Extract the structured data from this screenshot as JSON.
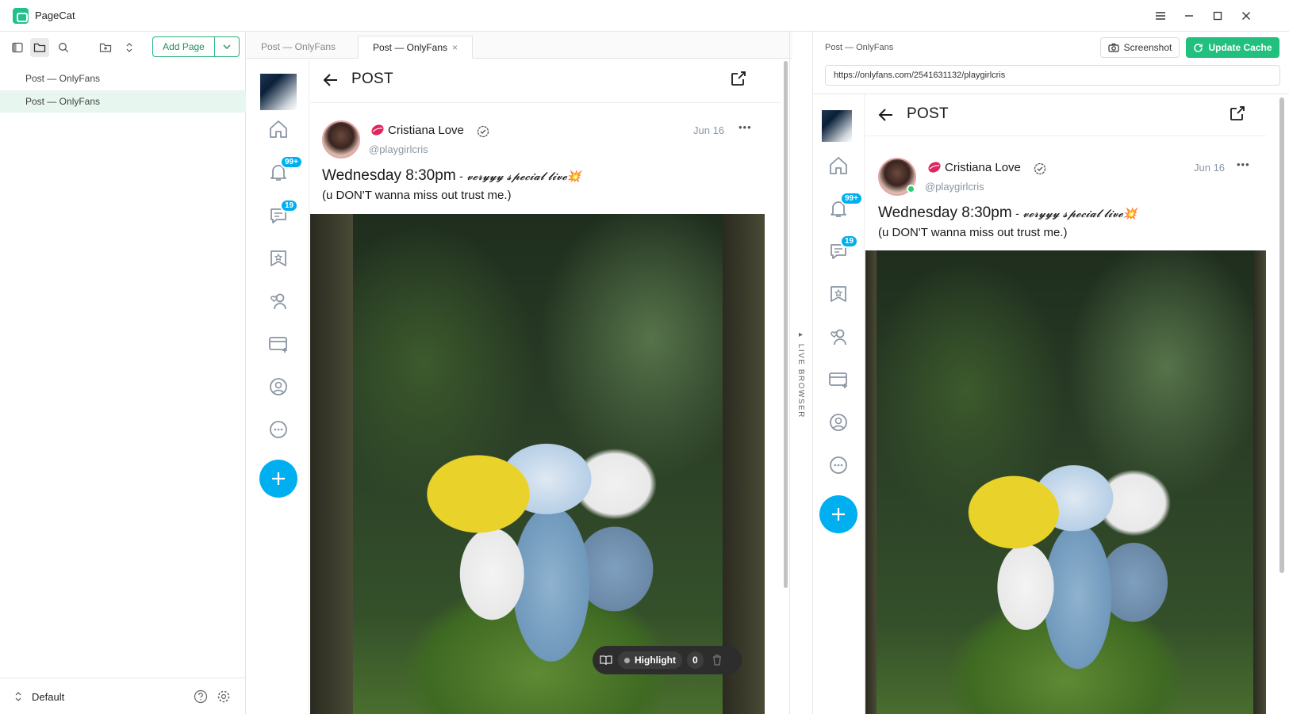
{
  "app": {
    "title": "PageCat"
  },
  "sidebar": {
    "add_page_label": "Add Page",
    "items": [
      {
        "label": "Post — OnlyFans"
      },
      {
        "label": "Post — OnlyFans"
      }
    ],
    "workspace_label": "Default"
  },
  "tabs": [
    {
      "label": "Post — OnlyFans"
    },
    {
      "label": "Post — OnlyFans",
      "close": "×"
    }
  ],
  "post": {
    "header_title": "POST",
    "author_name": "Cristiana Love",
    "author_handle": "@playgirlcris",
    "date": "Jun 16",
    "more": "•••",
    "text_main": "Wednesday 8:30pm",
    "text_fancy": " - 𝓿𝓮𝓻𝔂𝔂𝔂 𝓼𝓹𝓮𝓬𝓲𝓪𝓵 𝓵𝓲𝓿𝓮💥",
    "text_sub": "(u DON'T wanna miss out trust me.)"
  },
  "rail": {
    "notifications_badge": "99+",
    "messages_badge": "19"
  },
  "highlight": {
    "label": "Highlight",
    "count": "0"
  },
  "live_browser": {
    "strip_label": "▸ LIVE BROWSER",
    "title": "Post — OnlyFans",
    "screenshot_label": "Screenshot",
    "update_cache_label": "Update Cache",
    "url": "https://onlyfans.com/2541631132/playgirlcris"
  },
  "colors": {
    "accent_green": "#22c07e",
    "onlyfans_blue": "#00aff0"
  }
}
